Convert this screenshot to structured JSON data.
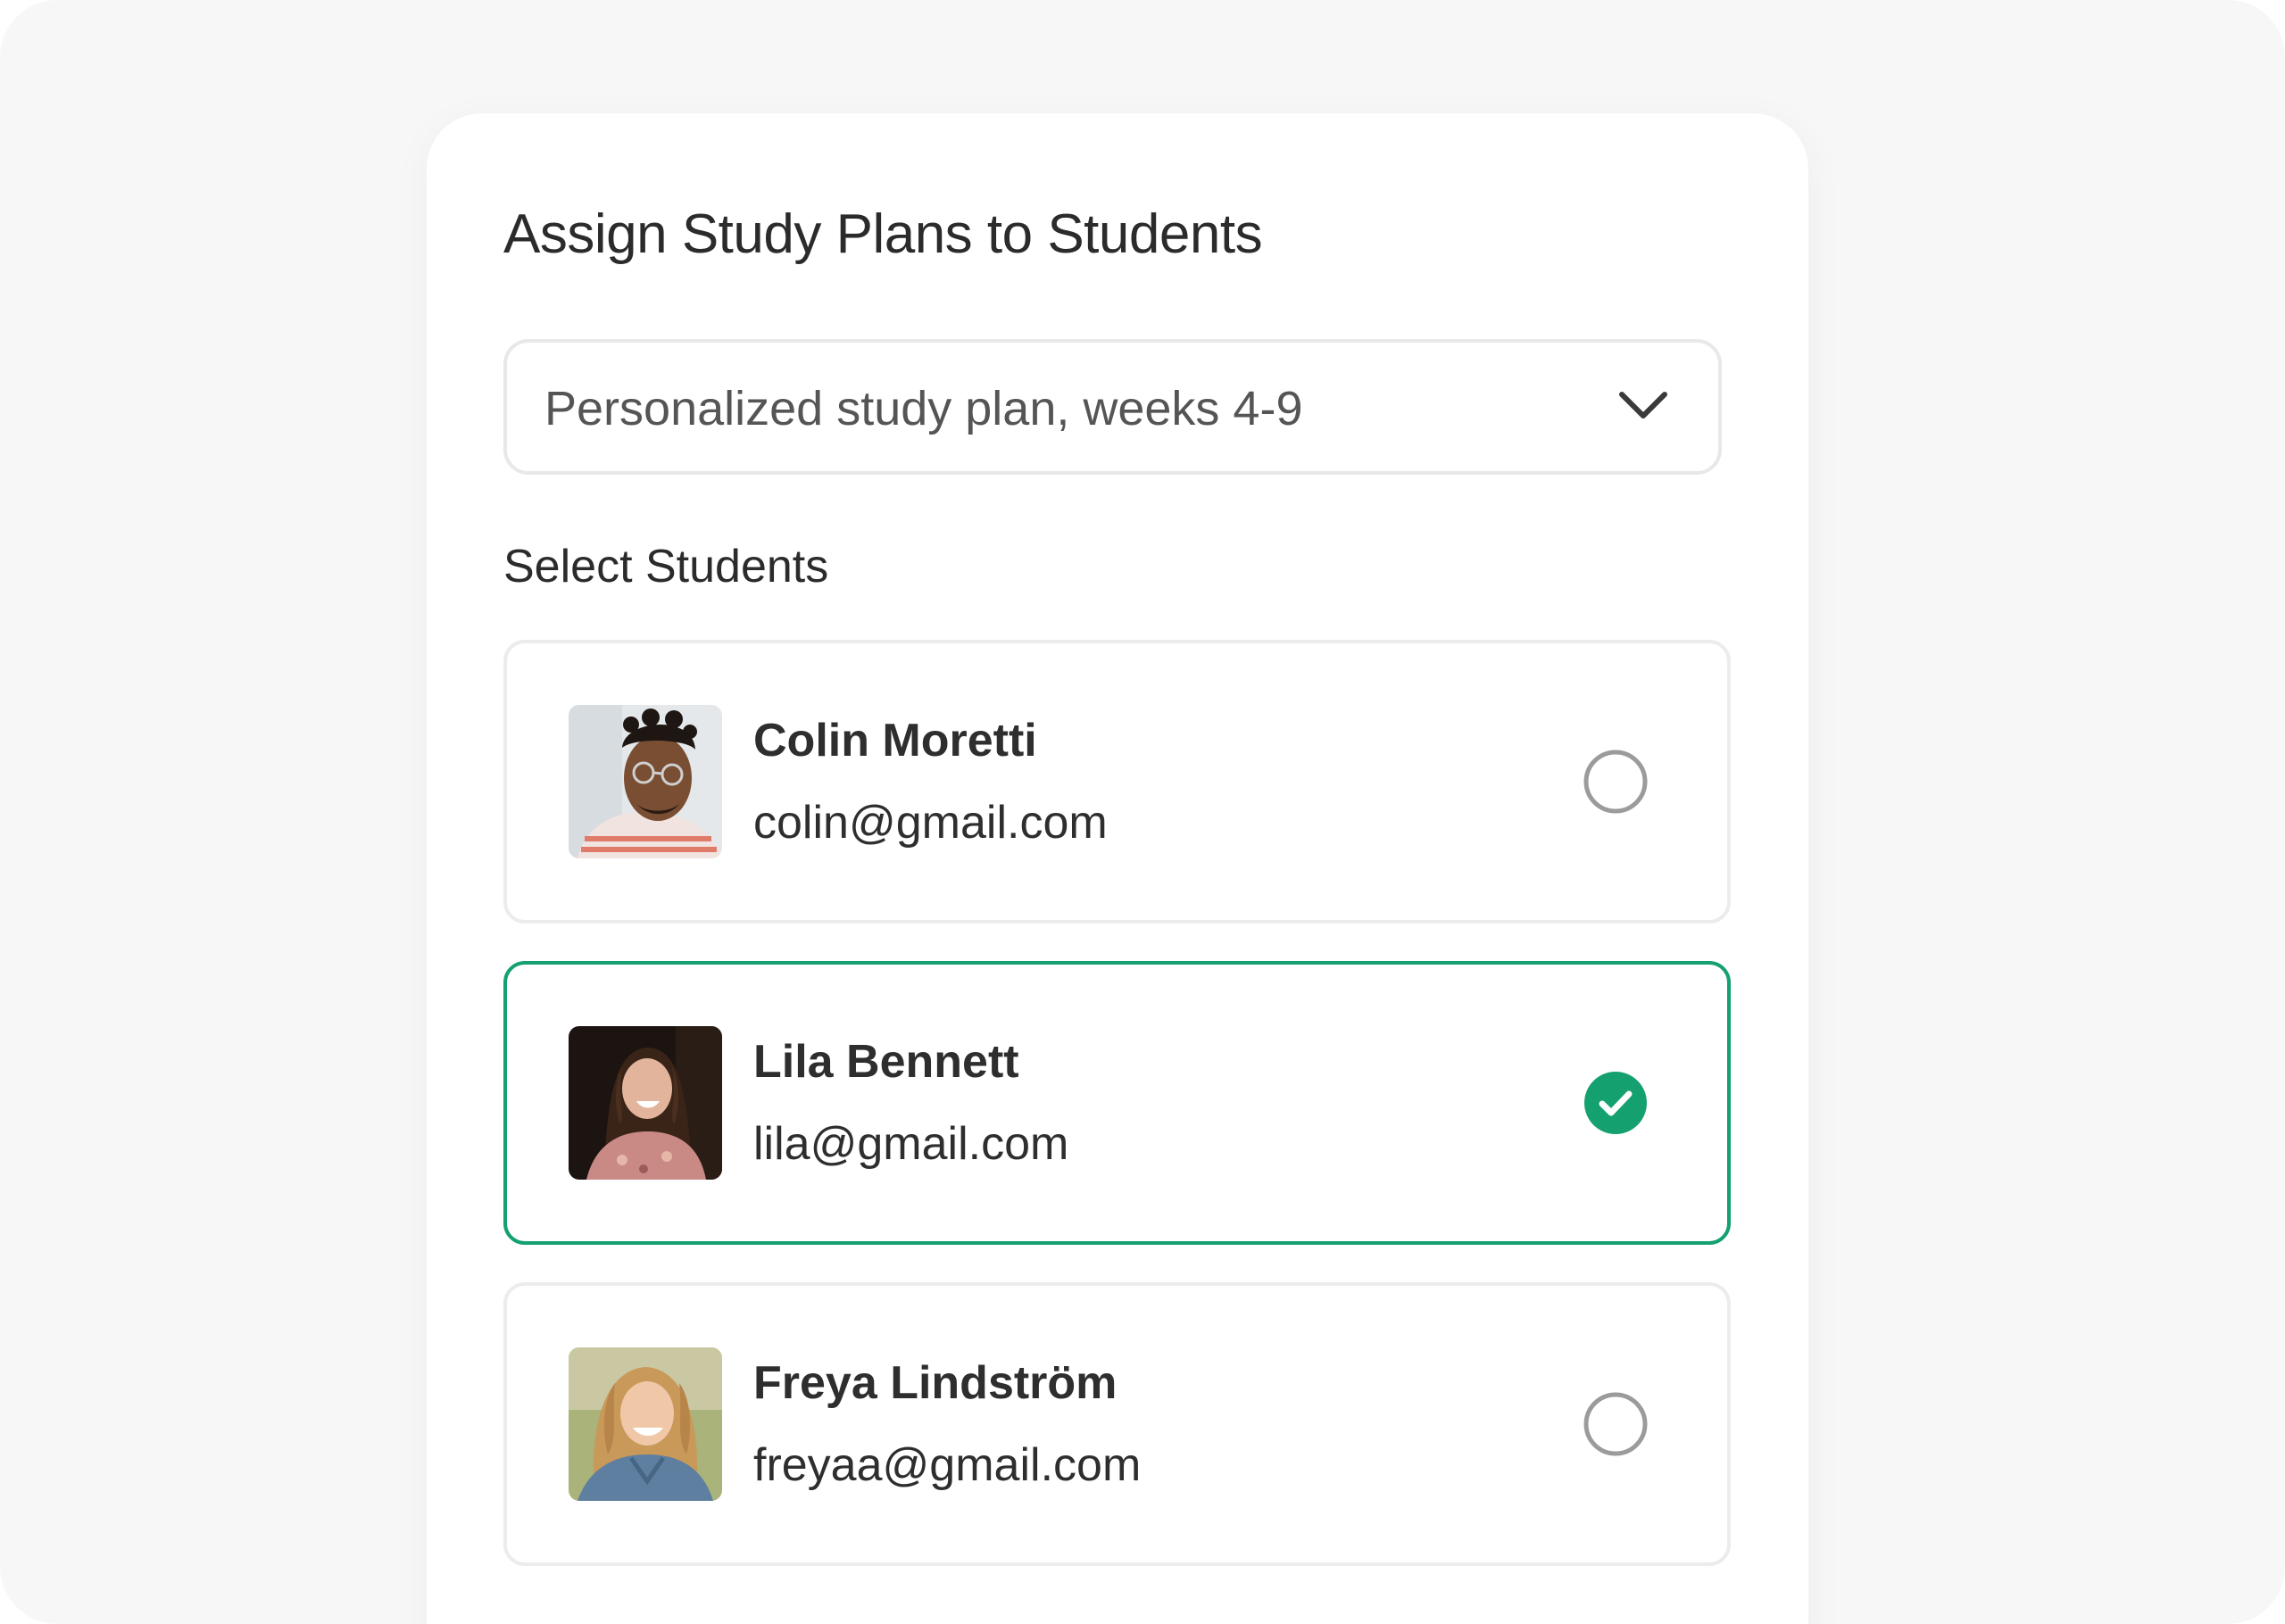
{
  "form": {
    "title": "Assign Study Plans to Students",
    "plan_select": {
      "value": "Personalized study plan, weeks 4-9",
      "icon": "chevron-down-icon"
    },
    "students_label": "Select Students"
  },
  "students": [
    {
      "name": "Colin Moretti",
      "email": "colin@gmail.com",
      "selected": false
    },
    {
      "name": "Lila Bennett",
      "email": "lila@gmail.com",
      "selected": true
    },
    {
      "name": "Freya Lindström",
      "email": "freyaa@gmail.com",
      "selected": false
    }
  ],
  "colors": {
    "accent": "#14a06f",
    "radio_unchecked": "#9b9b9b",
    "card_border": "#ececec",
    "text": "#2e2e2e"
  }
}
